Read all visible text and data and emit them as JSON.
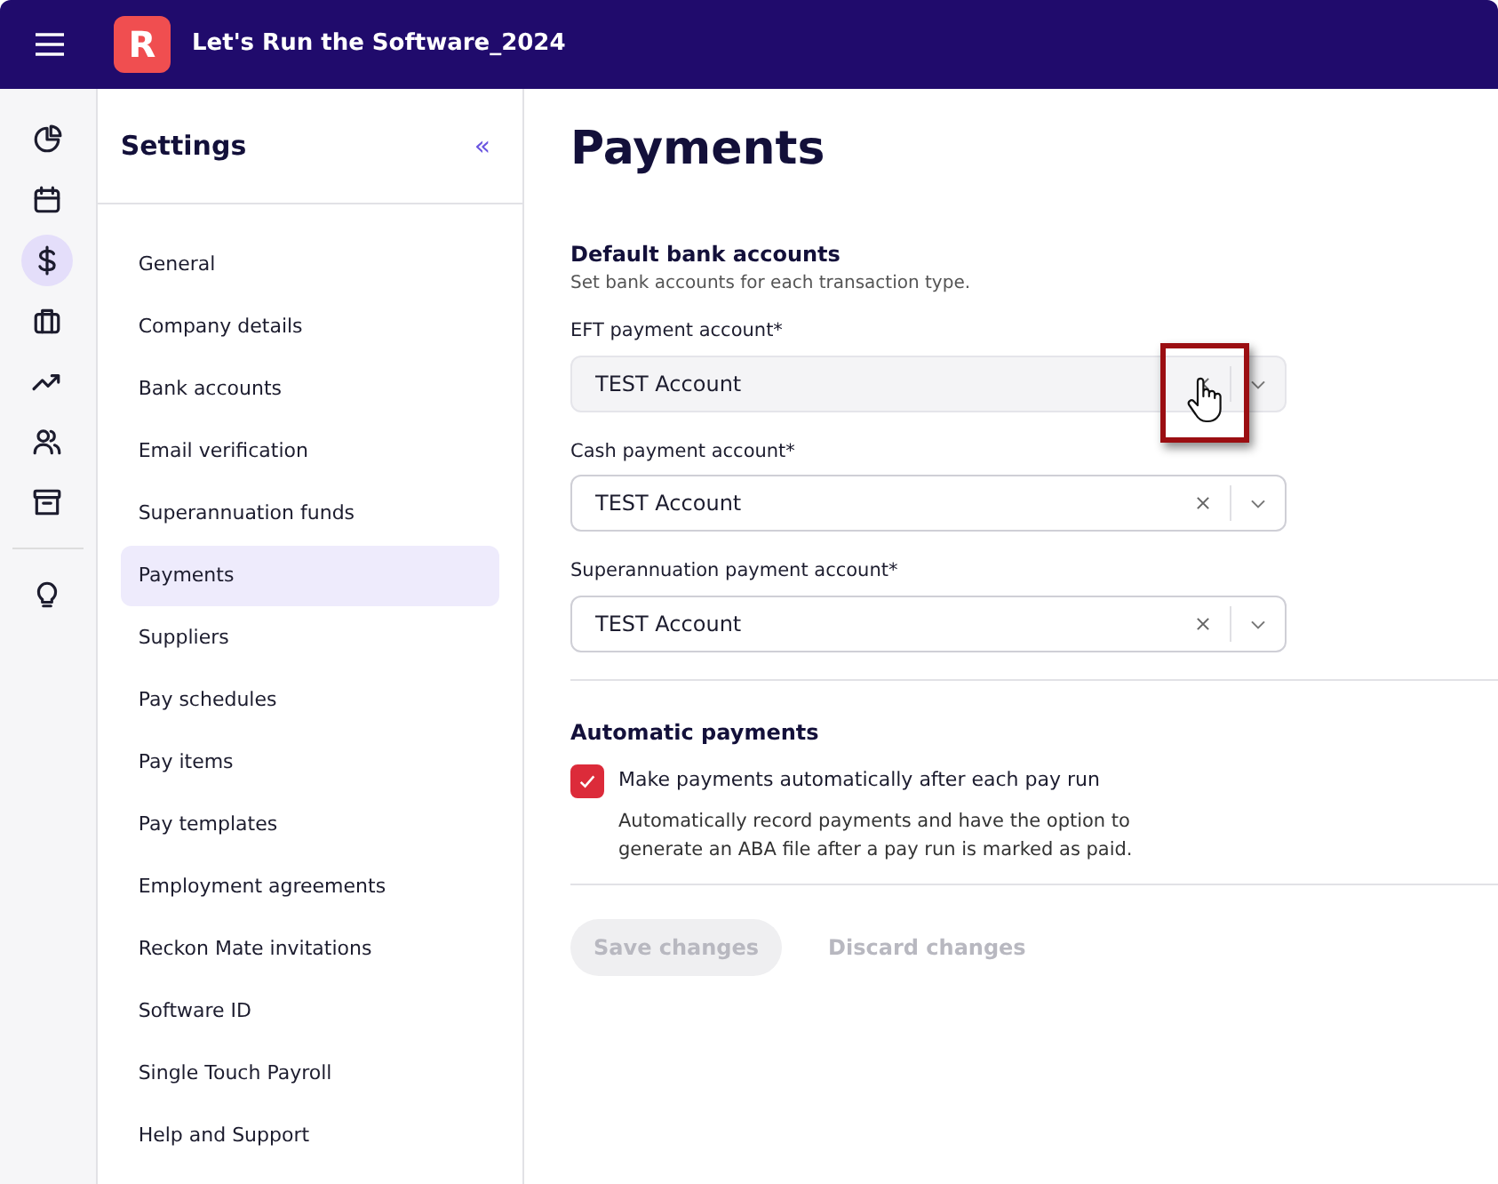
{
  "app_bar": {
    "logo": "R",
    "title": "Let's Run the Software_2024"
  },
  "rail": {
    "items": [
      {
        "selected": false
      },
      {
        "selected": false
      },
      {
        "selected": true
      },
      {
        "selected": false
      },
      {
        "selected": false
      },
      {
        "selected": false
      },
      {
        "selected": false
      }
    ],
    "bottom_items": [
      {
        "selected": false
      }
    ]
  },
  "settings_nav": {
    "title": "Settings",
    "collapse": "«",
    "items": [
      {
        "label": "General",
        "selected": false
      },
      {
        "label": "Company details",
        "selected": false
      },
      {
        "label": "Bank accounts",
        "selected": false
      },
      {
        "label": "Email verification",
        "selected": false
      },
      {
        "label": "Superannuation funds",
        "selected": false
      },
      {
        "label": "Payments",
        "selected": true
      },
      {
        "label": "Suppliers",
        "selected": false
      },
      {
        "label": "Pay schedules",
        "selected": false
      },
      {
        "label": "Pay items",
        "selected": false
      },
      {
        "label": "Pay templates",
        "selected": false
      },
      {
        "label": "Employment agreements",
        "selected": false
      },
      {
        "label": "Reckon Mate invitations",
        "selected": false
      },
      {
        "label": "Software ID",
        "selected": false
      },
      {
        "label": "Single Touch Payroll",
        "selected": false
      },
      {
        "label": "Help and Support",
        "selected": false
      }
    ]
  },
  "page": {
    "title": "Payments",
    "bank_section": {
      "title": "Default bank accounts",
      "subtitle": "Set bank accounts for each transaction type.",
      "fields": [
        {
          "label": "EFT payment account*",
          "value": "TEST Account",
          "hovered": true,
          "highlighted": true
        },
        {
          "label": "Cash payment account*",
          "value": "TEST Account",
          "hovered": false,
          "highlighted": false
        },
        {
          "label": "Superannuation payment account*",
          "value": "TEST Account",
          "hovered": false,
          "highlighted": false
        }
      ]
    },
    "auto_section": {
      "title": "Automatic payments",
      "checkbox": {
        "label": "Make payments automatically after each pay run",
        "checked": true,
        "help": "Automatically record payments and have the option to generate an ABA file after a pay run is marked as paid."
      }
    },
    "buttons": [
      {
        "label": "Save changes",
        "kind": "filled",
        "disabled": true
      },
      {
        "label": "Discard changes",
        "kind": "text",
        "disabled": true
      }
    ]
  }
}
